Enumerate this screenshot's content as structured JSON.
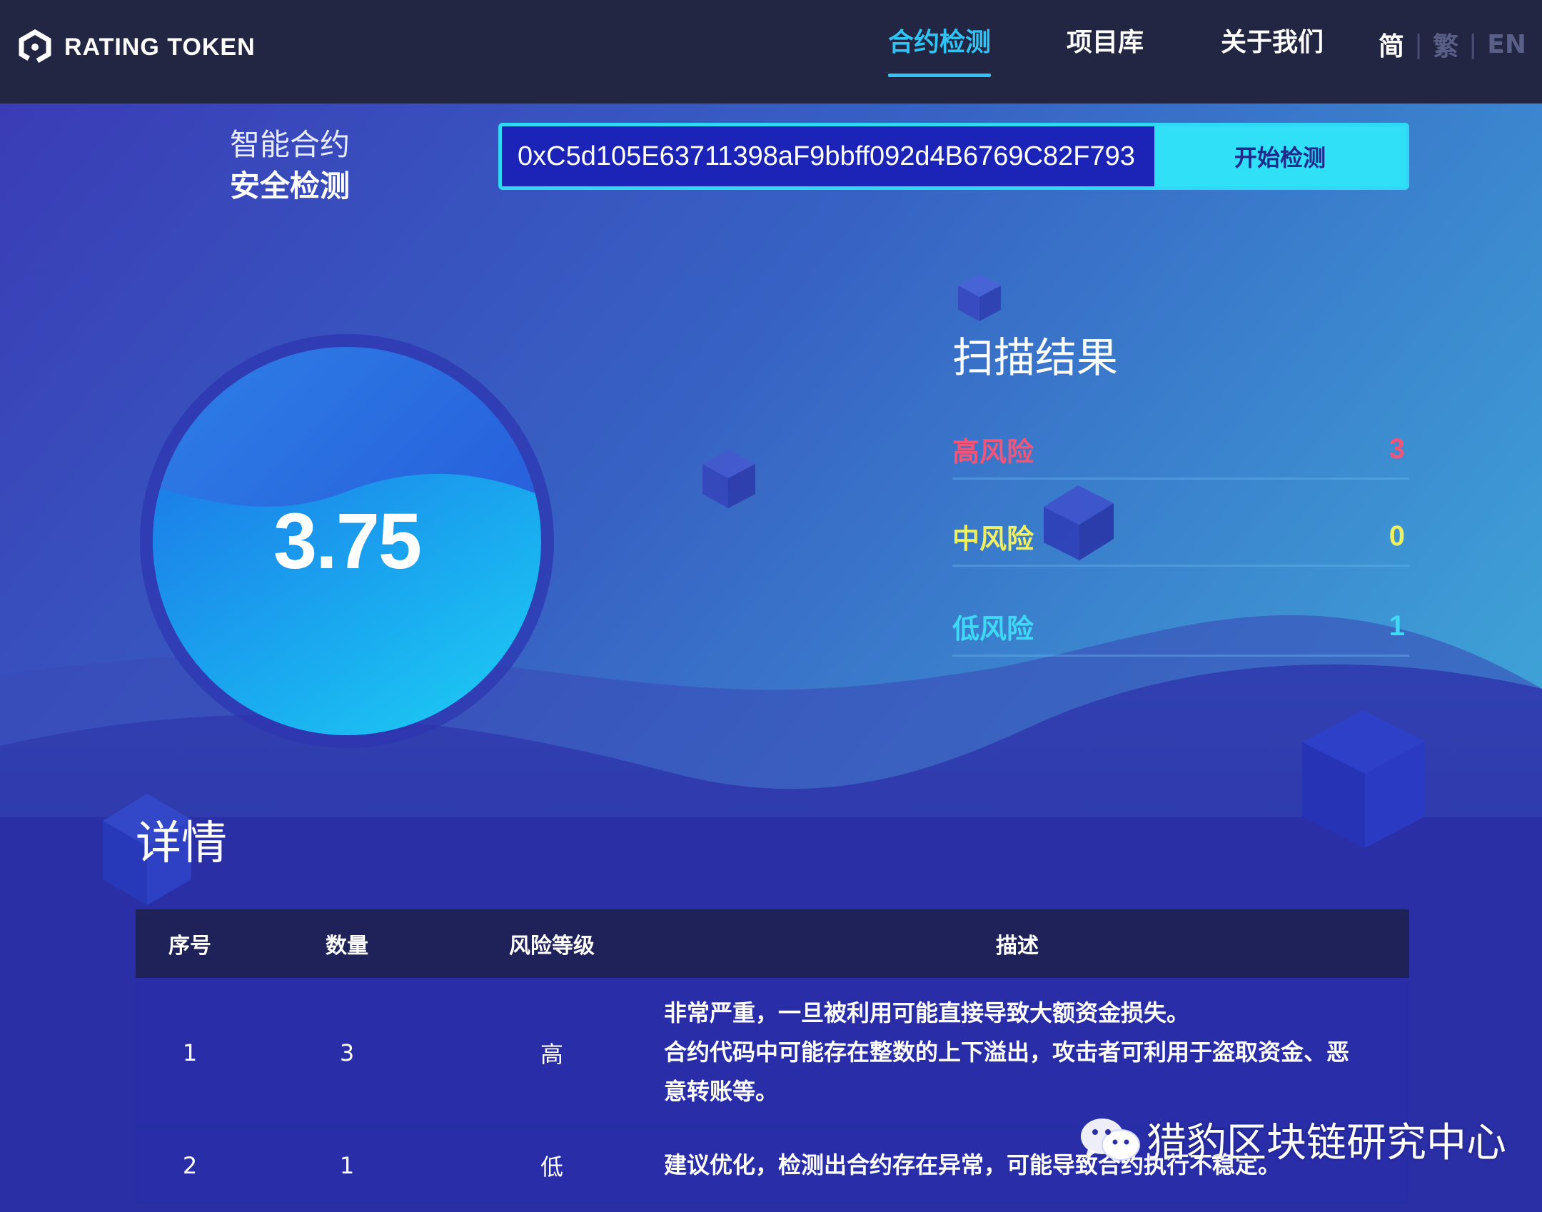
{
  "header": {
    "logo_text": "RATING TOKEN",
    "nav": [
      {
        "label": "合约检测",
        "active": true
      },
      {
        "label": "项目库",
        "active": false
      },
      {
        "label": "关于我们",
        "active": false
      }
    ],
    "lang": {
      "simplified": "简",
      "traditional": "繁",
      "english": "EN",
      "separator": "|"
    }
  },
  "search": {
    "title_line1": "智能合约",
    "title_line2": "安全检测",
    "address_value": "0xC5d105E63711398aF9bbff092d4B6769C82F793",
    "button_label": "开始检测"
  },
  "score": {
    "value": "3.75"
  },
  "scan_results": {
    "title": "扫描结果",
    "rows": [
      {
        "label": "高风险",
        "count": "3",
        "color": "#f0567a"
      },
      {
        "label": "中风险",
        "count": "0",
        "color": "#eef060"
      },
      {
        "label": "低风险",
        "count": "1",
        "color": "#3fd8f5"
      }
    ]
  },
  "details": {
    "title": "详情",
    "columns": [
      "序号",
      "数量",
      "风险等级",
      "描述"
    ],
    "rows": [
      {
        "index": "1",
        "count": "3",
        "level": "高",
        "description": [
          "非常严重，一旦被利用可能直接导致大额资金损失。",
          "合约代码中可能存在整数的上下溢出，攻击者可利用于盗取资金、恶",
          "意转账等。"
        ]
      },
      {
        "index": "2",
        "count": "1",
        "level": "低",
        "description": [
          "建议优化，检测出合约存在异常，可能导致合约执行不稳定。"
        ]
      }
    ]
  },
  "watermark": {
    "text": "猎豹区块链研究中心",
    "icon": "wechat-icon"
  },
  "colors": {
    "header_bg": "#232643",
    "accent_cyan": "#30c4f4",
    "button_bg": "#2fe0f7",
    "high_risk": "#f0567a",
    "mid_risk": "#eef060",
    "low_risk": "#3fd8f5",
    "table_header_bg": "#1f2258"
  }
}
